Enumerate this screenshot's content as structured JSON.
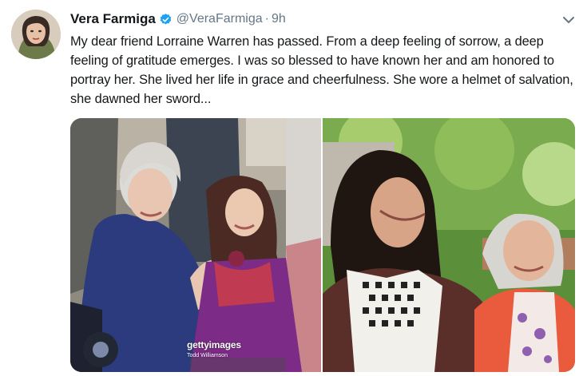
{
  "tweet": {
    "display_name": "Vera Farmiga",
    "handle": "@VeraFarmiga",
    "separator": "·",
    "time": "9h",
    "text": "My dear friend Lorraine Warren has passed. From a deep feeling of sorrow, a deep feeling of gratitude emerges. I was so blessed to have known her and am honored to portray her. She lived her life in grace and cheerfulness. She wore a helmet of salvation, she dawned her sword...",
    "media": {
      "watermark_brand": "gettyimages",
      "watermark_credit": "Todd Williamson"
    }
  },
  "icons": {
    "avatar": "avatar-portrait",
    "verified": "verified-badge-icon",
    "caret": "chevron-down-icon"
  },
  "colors": {
    "name": "#14171a",
    "secondary": "#657786",
    "verified_blue": "#1da1f2"
  }
}
